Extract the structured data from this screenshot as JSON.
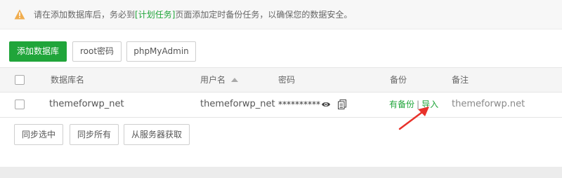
{
  "notice": {
    "icon": "warning-icon",
    "text_before": "请在添加数据库后，务必到",
    "link": "[计划任务]",
    "text_after": "页面添加定时备份任务，以确保您的数据安全。",
    "color": "#f0ad4e"
  },
  "toolbar": {
    "add_db": "添加数据库",
    "root_pwd": "root密码",
    "phpmyadmin": "phpMyAdmin"
  },
  "table": {
    "headers": {
      "name": "数据库名",
      "user": "用户名",
      "password": "密码",
      "backup": "备份",
      "remark": "备注"
    },
    "rows": [
      {
        "name": "themeforwp_net",
        "user": "themeforwp_net",
        "password": "**********",
        "backup": "有备份",
        "separator": "|",
        "import": "导入",
        "remark": "themeforwp.net"
      }
    ]
  },
  "bottom": {
    "sync_selected": "同步选中",
    "sync_all": "同步所有",
    "fetch_from_server": "从服务器获取"
  },
  "colors": {
    "accent": "#20a53a",
    "arrow": "#e8312a"
  }
}
